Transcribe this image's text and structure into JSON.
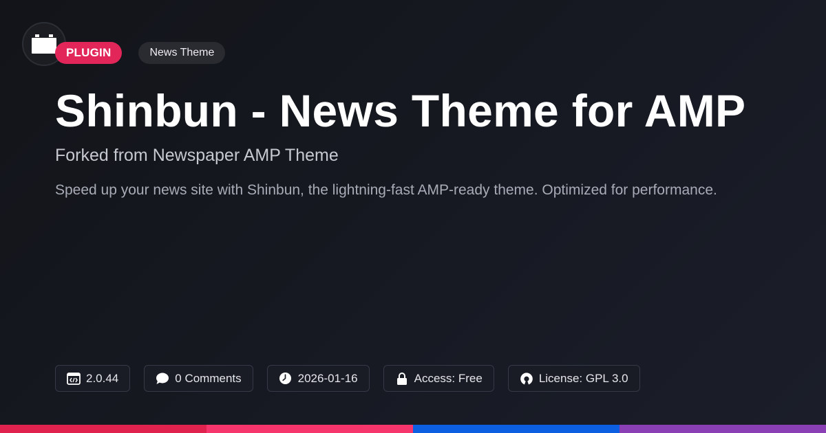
{
  "logo": {
    "icon": "plugin-block-icon"
  },
  "badges": {
    "type_label": "PLUGIN",
    "category_label": "News Theme"
  },
  "title": "Shinbun - News Theme for AMP",
  "subtitle": "Forked from Newspaper AMP Theme",
  "description": "Speed up your news site with Shinbun, the lightning-fast AMP-ready theme. Optimized for performance.",
  "meta": {
    "version": "2.0.44",
    "comments": "0 Comments",
    "date": "2026-01-16",
    "access": "Access: Free",
    "license": "License: GPL 3.0"
  },
  "colors": {
    "accent": "#e2265a",
    "stripe": [
      "#e0224f",
      "#f5356b",
      "#0b5fe0",
      "#8a3fb4"
    ]
  }
}
